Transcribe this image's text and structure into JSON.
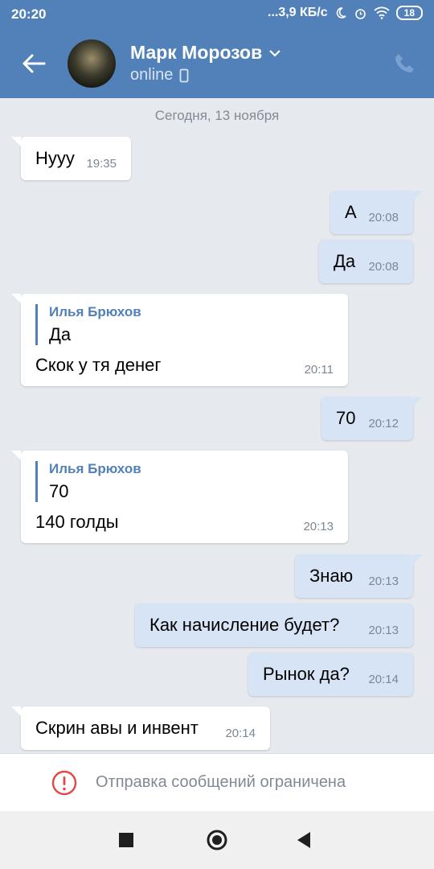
{
  "status_bar": {
    "time": "20:20",
    "network_speed": "...3,9 КБ/с",
    "battery": "18",
    "icons": [
      "moon-icon",
      "alarm-icon",
      "wifi-icon",
      "battery-icon"
    ]
  },
  "header": {
    "name": "Марк Морозов",
    "status": "online",
    "icons": [
      "back-arrow-icon",
      "chevron-down-icon",
      "mobile-icon",
      "phone-icon"
    ]
  },
  "chat": {
    "date": "Сегодня, 13 ноября",
    "messages": [
      {
        "text": "Нууу",
        "time": "19:35",
        "direction": "in"
      },
      {
        "text": "А",
        "time": "20:08",
        "direction": "out"
      },
      {
        "text": "Да",
        "time": "20:08",
        "direction": "out"
      },
      {
        "quote_author": "Илья Брюхов",
        "quote_text": "Да",
        "text": "Скок у тя денег",
        "time": "20:11",
        "direction": "in"
      },
      {
        "text": "70",
        "time": "20:12",
        "direction": "out"
      },
      {
        "quote_author": "Илья Брюхов",
        "quote_text": "70",
        "text": "140 голды",
        "time": "20:13",
        "direction": "in"
      },
      {
        "text": "Знаю",
        "time": "20:13",
        "direction": "out"
      },
      {
        "text": "Как начисление будет?",
        "time": "20:13",
        "direction": "out"
      },
      {
        "text": "Рынок да?",
        "time": "20:14",
        "direction": "out"
      },
      {
        "text": "Скрин авы и инвент",
        "time": "20:14",
        "direction": "in"
      }
    ]
  },
  "restriction": {
    "label": "Отправка сообщений ограничена",
    "icon": "warning-circle-icon"
  },
  "colors": {
    "header": "#5181b8",
    "outgoing_bubble": "#d7e4f5",
    "incoming_bubble": "#ffffff",
    "background": "#e6e9ee",
    "warning": "#e64646"
  }
}
